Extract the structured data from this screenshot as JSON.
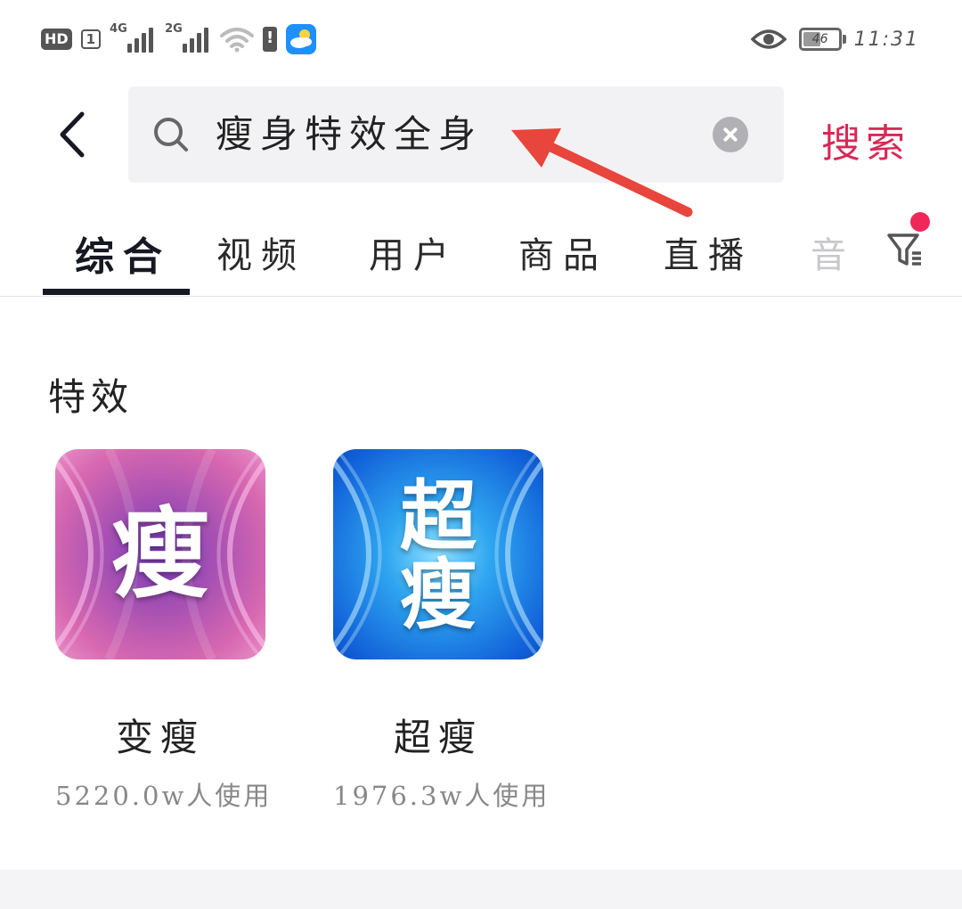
{
  "status_bar": {
    "hd_label": "HD",
    "hd_sim": "1",
    "signal_1_label": "4G",
    "signal_2_label": "2G",
    "battery_level": "46",
    "time": "11:31",
    "icons": [
      "hd-icon",
      "signal-4g-icon",
      "signal-2g-icon",
      "wifi-icon",
      "battery-warning-icon",
      "weather-app-icon",
      "eye-icon",
      "battery-icon"
    ]
  },
  "search": {
    "query": "瘦身特效全身",
    "submit_label": "搜索"
  },
  "tabs": [
    {
      "label": "综合",
      "active": true
    },
    {
      "label": "视频"
    },
    {
      "label": "用户"
    },
    {
      "label": "商品"
    },
    {
      "label": "直播"
    },
    {
      "label": "音"
    }
  ],
  "section": {
    "title": "特效",
    "effects": [
      {
        "thumb_text": "瘦",
        "name": "变瘦",
        "usage": "5220.0w人使用"
      },
      {
        "thumb_text_1": "超",
        "thumb_text_2": "瘦",
        "name": "超瘦",
        "usage": "1976.3w人使用"
      }
    ]
  },
  "colors": {
    "accent": "#d62a57",
    "notification_dot": "#f0285a",
    "annotation_arrow": "#e8453c",
    "search_bg": "#f2f2f4"
  }
}
